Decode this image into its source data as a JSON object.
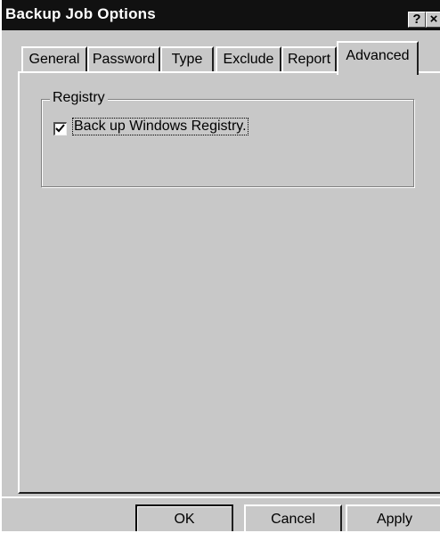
{
  "window": {
    "title": "Backup Job Options",
    "help_glyph": "?",
    "close_glyph": "×"
  },
  "tabs": [
    {
      "label": "General",
      "active": false
    },
    {
      "label": "Password",
      "active": false
    },
    {
      "label": "Type",
      "active": false
    },
    {
      "label": "Exclude",
      "active": false
    },
    {
      "label": "Report",
      "active": false
    },
    {
      "label": "Advanced",
      "active": true
    }
  ],
  "registry_group": {
    "label": "Registry",
    "checkbox": {
      "label": "Back up Windows Registry.",
      "checked": true
    }
  },
  "buttons": {
    "ok": "OK",
    "cancel": "Cancel",
    "apply": "Apply"
  },
  "colors": {
    "face": "#c8c8c8",
    "titlebar": "#111111"
  }
}
